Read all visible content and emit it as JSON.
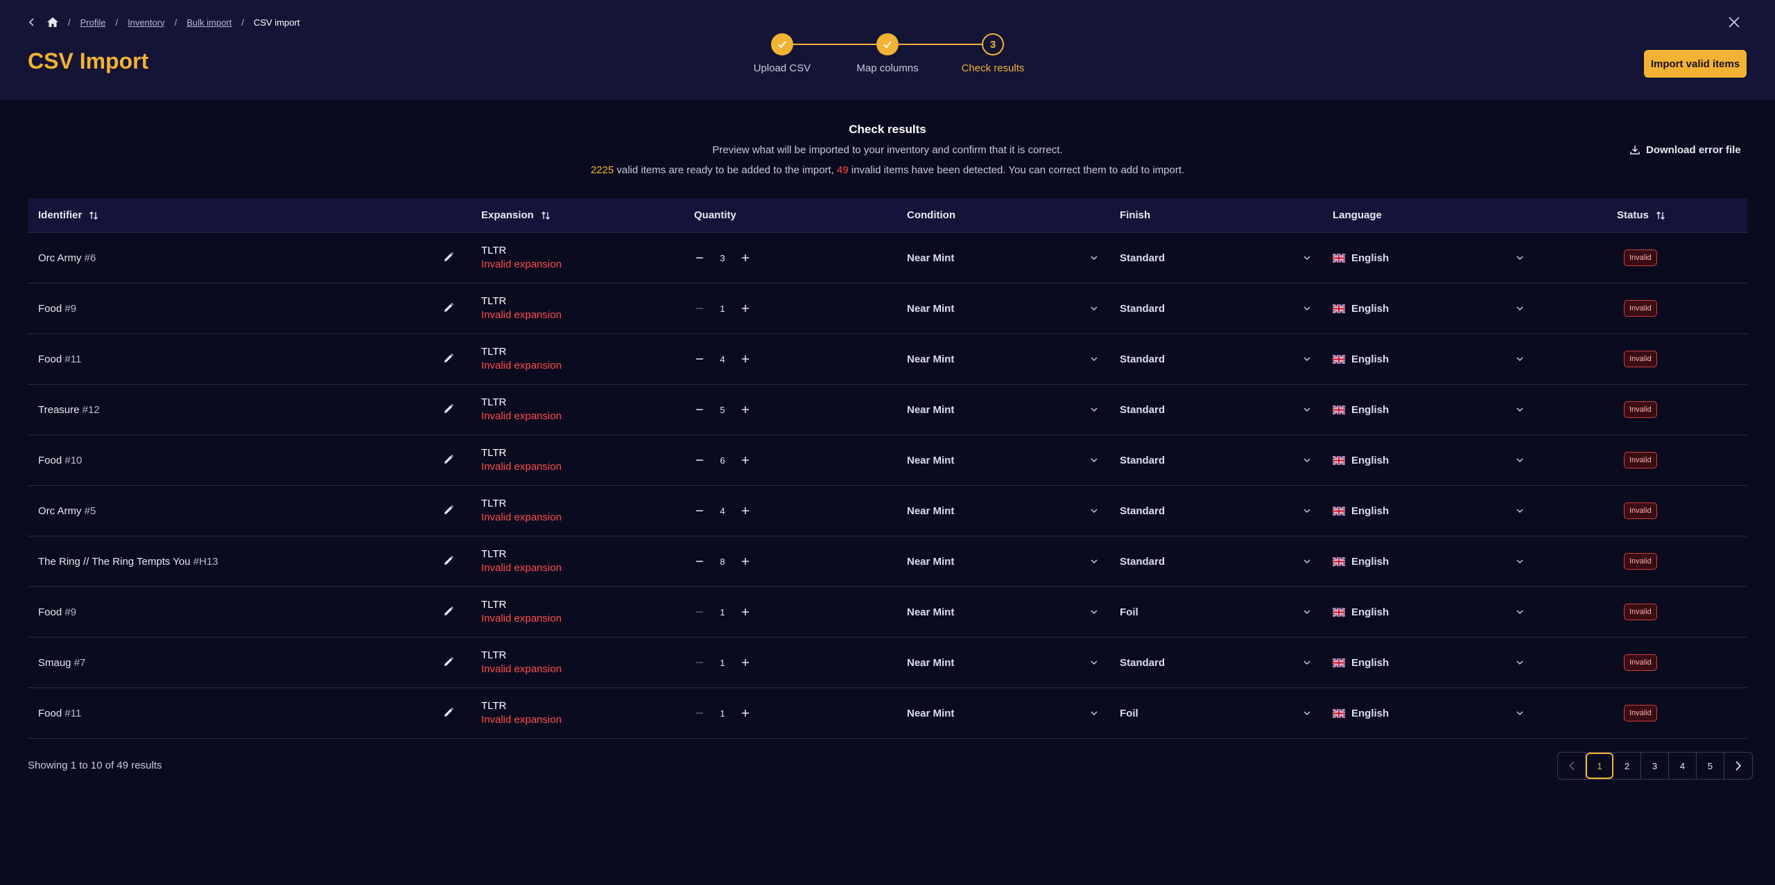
{
  "colors": {
    "accent": "#f2b233",
    "error": "#ff4d4d",
    "header_bg": "#131436",
    "page_bg": "#0b0b1f"
  },
  "breadcrumb": {
    "items": [
      "Profile",
      "Inventory",
      "Bulk import"
    ],
    "current": "CSV import"
  },
  "header": {
    "title": "CSV Import",
    "import_button": "Import valid items"
  },
  "stepper": {
    "steps": [
      {
        "label": "Upload CSV",
        "state": "done"
      },
      {
        "label": "Map columns",
        "state": "done"
      },
      {
        "label": "Check results",
        "state": "current",
        "number": "3"
      }
    ]
  },
  "summary": {
    "title": "Check results",
    "description": "Preview what will be imported to your inventory and confirm that it is correct.",
    "valid_count": "2225",
    "valid_text": " valid items are ready to be added to the import, ",
    "invalid_count": "49",
    "invalid_text": " invalid items have been detected. You can correct them to add to import.",
    "download_label": "Download error file"
  },
  "table": {
    "headers": {
      "identifier": "Identifier",
      "expansion": "Expansion",
      "quantity": "Quantity",
      "condition": "Condition",
      "finish": "Finish",
      "language": "Language",
      "status": "Status"
    },
    "rows": [
      {
        "name": "Orc Army",
        "number": "#6",
        "expansion": "TLTR",
        "expansion_error": "Invalid expansion",
        "quantity": "3",
        "condition": "Near Mint",
        "finish": "Standard",
        "language": "English",
        "status": "Invalid"
      },
      {
        "name": "Food",
        "number": "#9",
        "expansion": "TLTR",
        "expansion_error": "Invalid expansion",
        "quantity": "1",
        "condition": "Near Mint",
        "finish": "Standard",
        "language": "English",
        "status": "Invalid"
      },
      {
        "name": "Food",
        "number": "#11",
        "expansion": "TLTR",
        "expansion_error": "Invalid expansion",
        "quantity": "4",
        "condition": "Near Mint",
        "finish": "Standard",
        "language": "English",
        "status": "Invalid"
      },
      {
        "name": "Treasure",
        "number": "#12",
        "expansion": "TLTR",
        "expansion_error": "Invalid expansion",
        "quantity": "5",
        "condition": "Near Mint",
        "finish": "Standard",
        "language": "English",
        "status": "Invalid"
      },
      {
        "name": "Food",
        "number": "#10",
        "expansion": "TLTR",
        "expansion_error": "Invalid expansion",
        "quantity": "6",
        "condition": "Near Mint",
        "finish": "Standard",
        "language": "English",
        "status": "Invalid"
      },
      {
        "name": "Orc Army",
        "number": "#5",
        "expansion": "TLTR",
        "expansion_error": "Invalid expansion",
        "quantity": "4",
        "condition": "Near Mint",
        "finish": "Standard",
        "language": "English",
        "status": "Invalid"
      },
      {
        "name": "The Ring // The Ring Tempts You",
        "number": "#H13",
        "expansion": "TLTR",
        "expansion_error": "Invalid expansion",
        "quantity": "8",
        "condition": "Near Mint",
        "finish": "Standard",
        "language": "English",
        "status": "Invalid"
      },
      {
        "name": "Food",
        "number": "#9",
        "expansion": "TLTR",
        "expansion_error": "Invalid expansion",
        "quantity": "1",
        "condition": "Near Mint",
        "finish": "Foil",
        "language": "English",
        "status": "Invalid"
      },
      {
        "name": "Smaug",
        "number": "#7",
        "expansion": "TLTR",
        "expansion_error": "Invalid expansion",
        "quantity": "1",
        "condition": "Near Mint",
        "finish": "Standard",
        "language": "English",
        "status": "Invalid"
      },
      {
        "name": "Food",
        "number": "#11",
        "expansion": "TLTR",
        "expansion_error": "Invalid expansion",
        "quantity": "1",
        "condition": "Near Mint",
        "finish": "Foil",
        "language": "English",
        "status": "Invalid"
      }
    ]
  },
  "footer": {
    "results_text": "Showing 1 to 10 of 49 results",
    "pages": [
      "1",
      "2",
      "3",
      "4",
      "5"
    ],
    "current_page": "1"
  }
}
